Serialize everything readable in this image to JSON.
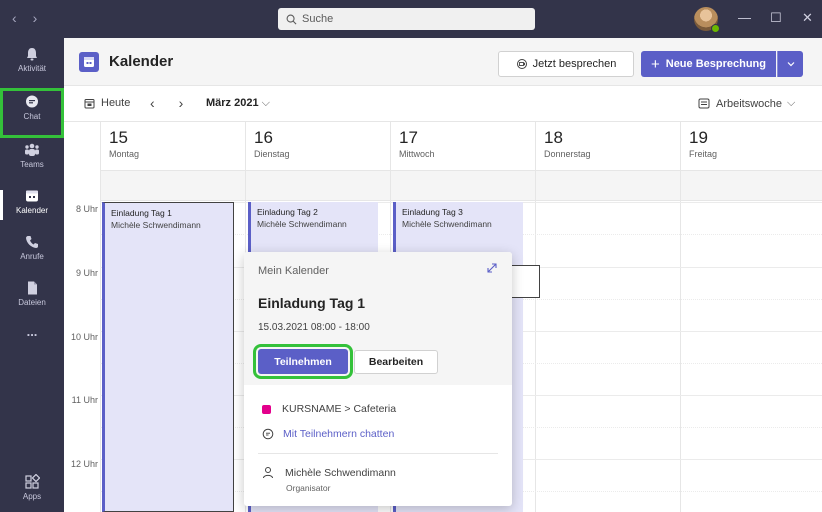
{
  "titlebar": {
    "back": "‹",
    "forward": "›",
    "search_placeholder": "Suche",
    "minimize": "—",
    "maximize": "☐",
    "close": "✕"
  },
  "rail": {
    "items": [
      {
        "label": "Aktivität",
        "icon": "bell-icon"
      },
      {
        "label": "Chat",
        "icon": "chat-icon"
      },
      {
        "label": "Teams",
        "icon": "teams-icon"
      },
      {
        "label": "Kalender",
        "icon": "calendar-icon"
      },
      {
        "label": "Anrufe",
        "icon": "phone-icon"
      },
      {
        "label": "Dateien",
        "icon": "file-icon"
      },
      {
        "label": "...",
        "icon": "more-icon"
      },
      {
        "label": "Apps",
        "icon": "apps-icon"
      }
    ]
  },
  "header": {
    "title": "Kalender",
    "meet_now": "Jetzt besprechen",
    "new_meeting": "Neue Besprechung"
  },
  "toolbar": {
    "today": "Heute",
    "month": "März 2021",
    "view": "Arbeitswoche"
  },
  "days": [
    {
      "num": "15",
      "name": "Montag"
    },
    {
      "num": "16",
      "name": "Dienstag"
    },
    {
      "num": "17",
      "name": "Mittwoch"
    },
    {
      "num": "18",
      "name": "Donnerstag"
    },
    {
      "num": "19",
      "name": "Freitag"
    }
  ],
  "hours": [
    "8 Uhr",
    "9 Uhr",
    "10 Uhr",
    "11 Uhr",
    "12 Uhr"
  ],
  "events": [
    {
      "title": "Einladung Tag 1",
      "organizer": "Michèle Schwendimann"
    },
    {
      "title": "Einladung Tag 2",
      "organizer": "Michèle Schwendimann"
    },
    {
      "title": "Einladung Tag 3",
      "organizer": "Michèle Schwendimann"
    }
  ],
  "popup": {
    "calendar": "Mein Kalender",
    "title": "Einladung Tag 1",
    "time": "15.03.2021 08:00 - 18:00",
    "join": "Teilnehmen",
    "edit": "Bearbeiten",
    "channel": "KURSNAME > Cafeteria",
    "chat_link": "Mit Teilnehmern chatten",
    "organizer_name": "Michèle Schwendimann",
    "organizer_role": "Organisator"
  },
  "colors": {
    "accent": "#5b5fc7",
    "rail": "#33344a",
    "highlight": "#34c13a",
    "channel": "#e3008c"
  }
}
